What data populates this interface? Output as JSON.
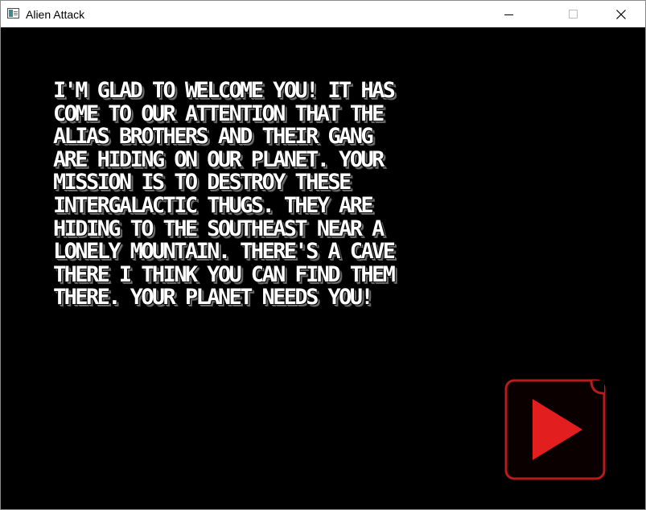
{
  "window": {
    "title": "Alien Attack",
    "app_icon": "window-app-icon",
    "controls": [
      "minimize-icon",
      "maximize-icon",
      "close-icon"
    ]
  },
  "game": {
    "story_lines": [
      "I'M GLAD TO WELCOME YOU! IT HAS",
      "COME TO OUR ATTENTION THAT THE",
      "ALIAS BROTHERS AND THEIR GANG",
      "ARE HIDING ON OUR PLANET. YOUR",
      "MISSION IS TO DESTROY THESE",
      "INTERGALACTIC THUGS. THEY ARE",
      "HIDING TO THE SOUTHEAST NEAR A",
      "LONELY MOUNTAIN. THERE'S A CAVE",
      "THERE I THINK YOU CAN FIND THEM",
      "THERE. YOUR PLANET NEEDS YOU!"
    ],
    "play_button": {
      "icon": "play-icon",
      "border_color": "#b71c1c",
      "fill_color": "#0b0000",
      "triangle_color": "#e21e1e"
    }
  }
}
